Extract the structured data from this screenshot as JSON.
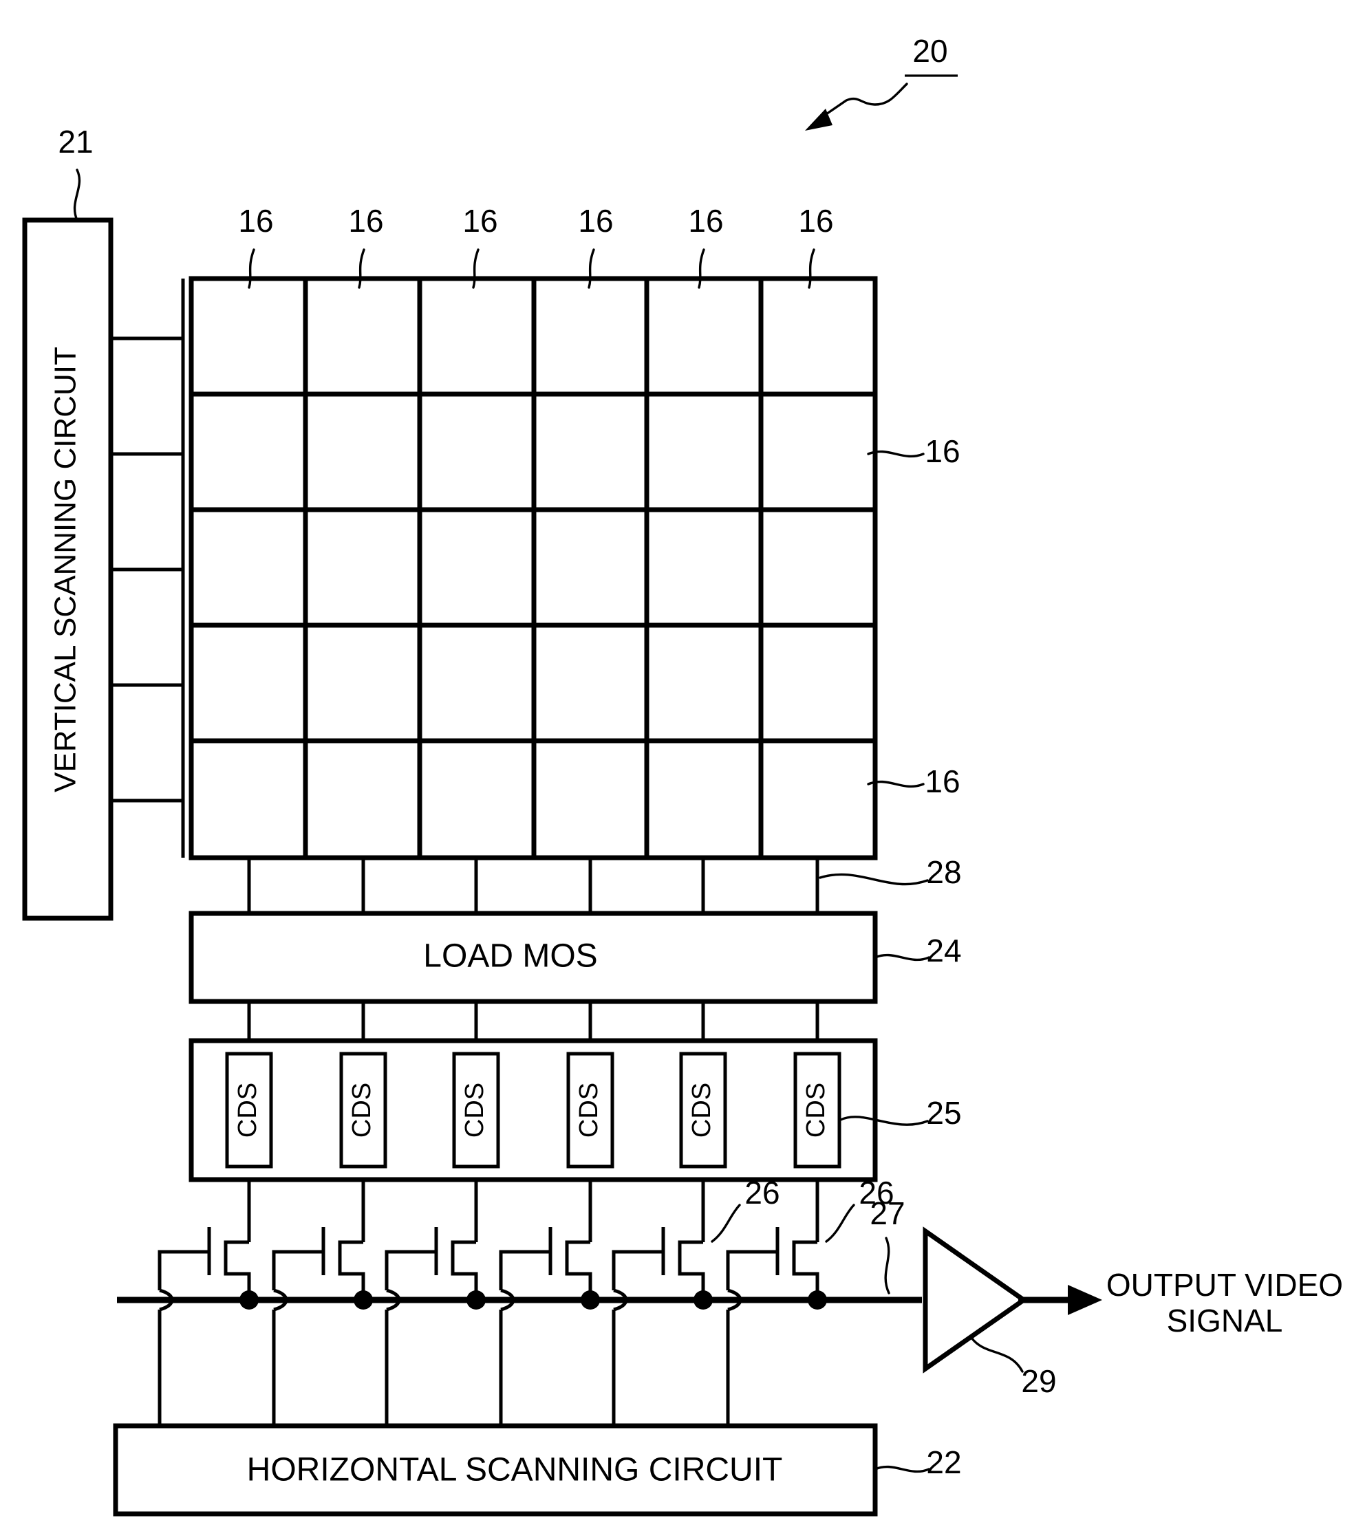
{
  "figure": {
    "type": "patent-block-diagram",
    "title_label": "20",
    "title_label_underlined": true,
    "background_color": "#ffffff",
    "line_color": "#000000"
  },
  "blocks": {
    "vertical_scanning_circuit": {
      "label": "VERTICAL SCANNING CIRCUIT",
      "reference": "21",
      "orientation": "vertical-bottom-to-top"
    },
    "load_mos": {
      "label": "LOAD MOS",
      "reference": "24",
      "orientation": "horizontal"
    },
    "cds_bank": {
      "reference": "25",
      "cell_label": "CDS",
      "cell_count": 6,
      "cells": [
        "CDS",
        "CDS",
        "CDS",
        "CDS",
        "CDS",
        "CDS"
      ],
      "orientation": "vertical-bottom-to-top"
    },
    "horizontal_scanning_circuit": {
      "label": "HORIZONTAL SCANNING CIRCUIT",
      "reference": "22",
      "orientation": "horizontal"
    },
    "output_amplifier": {
      "reference": "29",
      "shape": "triangle"
    }
  },
  "pixel_array": {
    "reference": "16",
    "columns": 6,
    "rows": 5,
    "column_labels": [
      "16",
      "16",
      "16",
      "16",
      "16",
      "16"
    ],
    "side_labels": [
      "16",
      "16"
    ]
  },
  "signal_lines": {
    "vertical_signal_line_reference": "28",
    "horizontal_output_line_reference": "27",
    "horizontal_select_transistor_references": [
      "26",
      "26"
    ]
  },
  "output": {
    "line1": "OUTPUT VIDEO",
    "line2": "SIGNAL"
  },
  "references": {
    "r16": "16",
    "r20": "20",
    "r21": "21",
    "r22": "22",
    "r24": "24",
    "r25": "25",
    "r26": "26",
    "r27": "27",
    "r28": "28",
    "r29": "29"
  }
}
